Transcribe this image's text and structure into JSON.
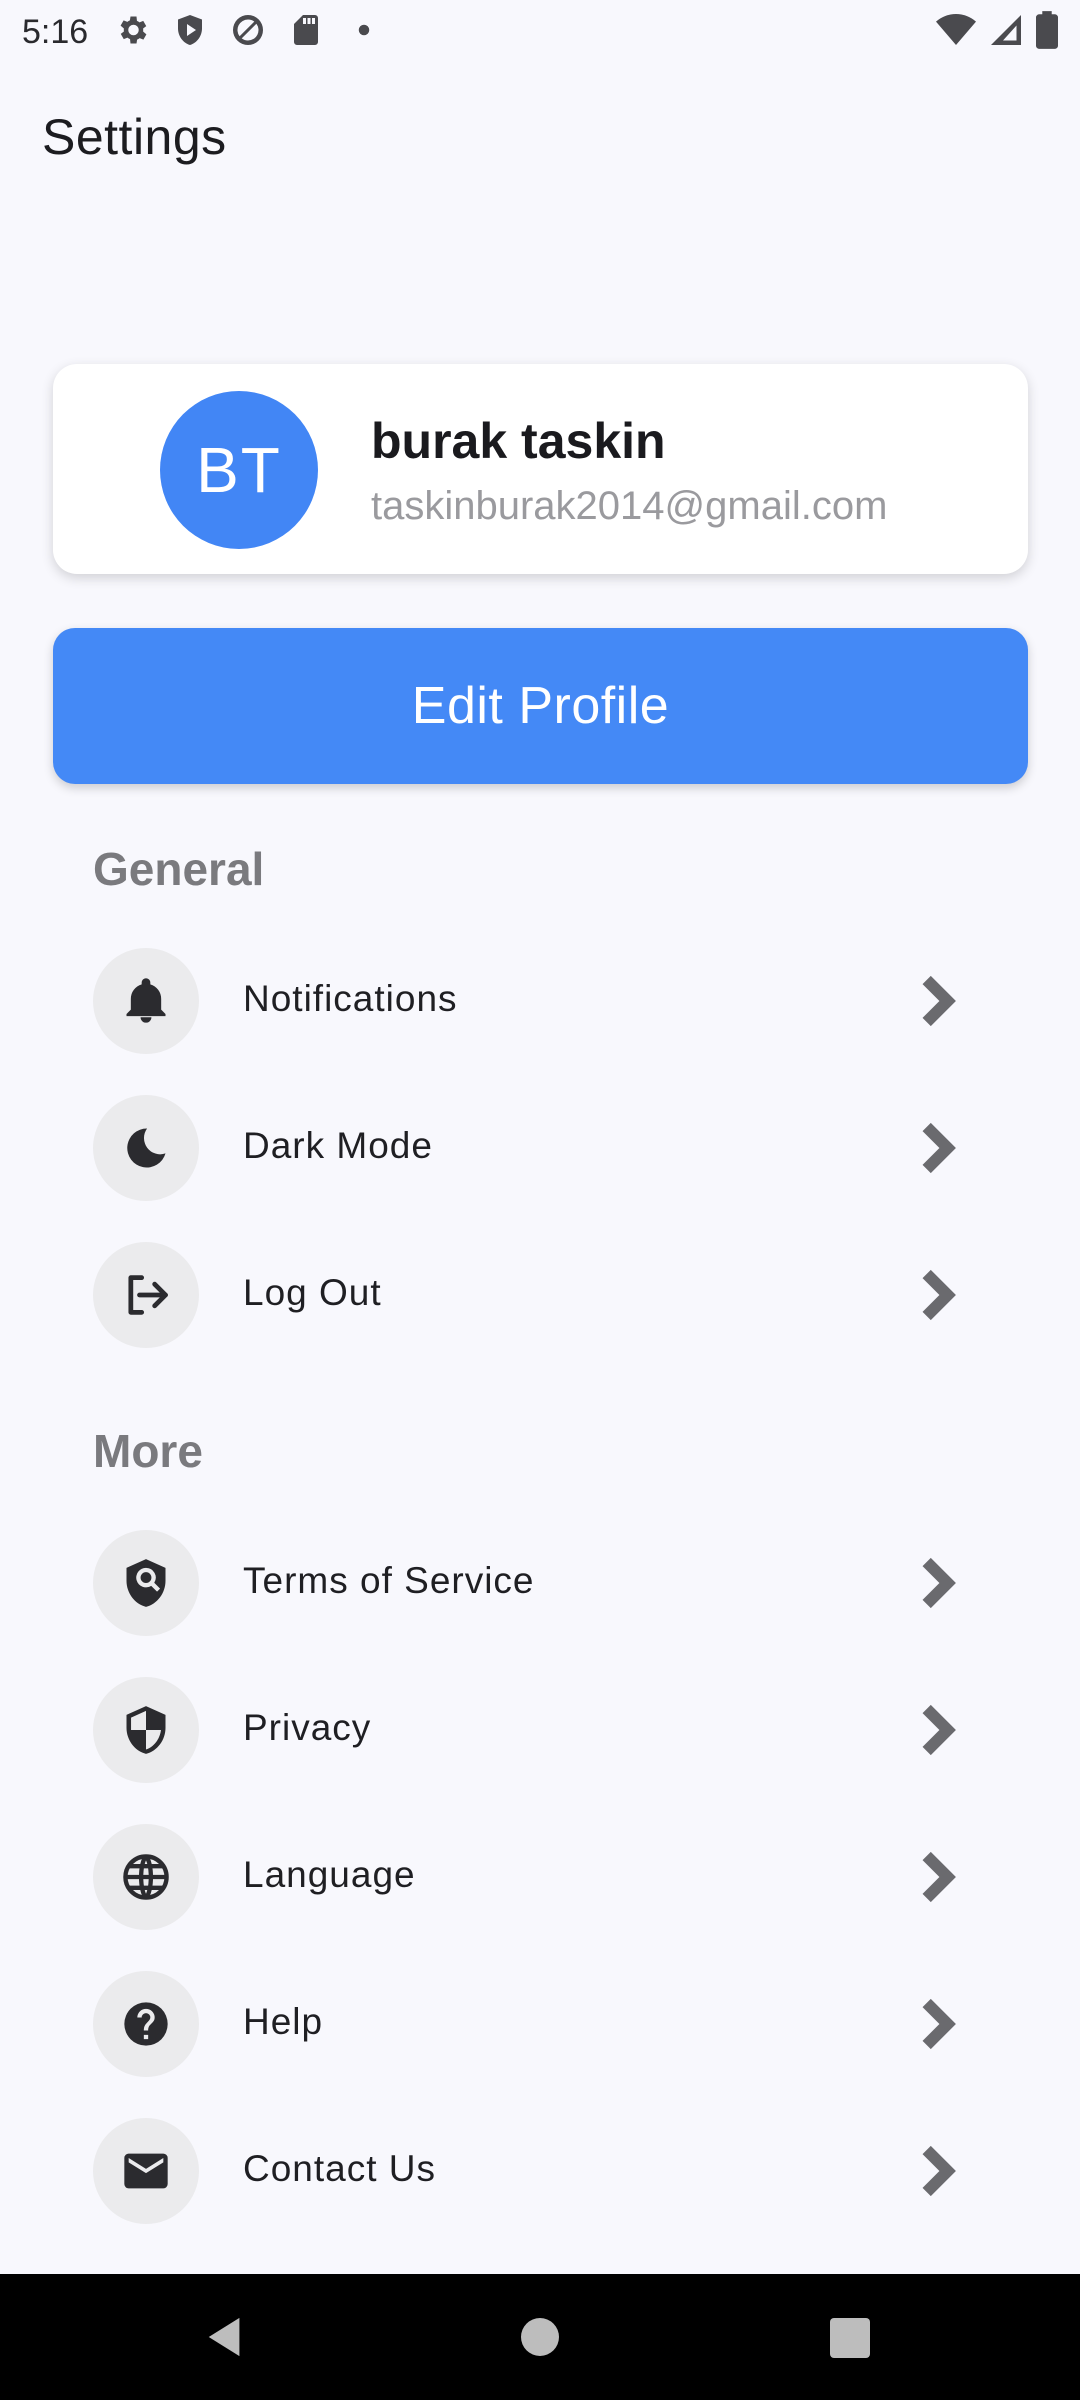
{
  "status_bar": {
    "time": "5:16",
    "left_icons": [
      "gear-icon",
      "shield-play-icon",
      "no-entry-icon",
      "sd-card-icon",
      "dot-icon"
    ],
    "right_icons": [
      "wifi-icon",
      "cell-signal-icon",
      "battery-icon"
    ]
  },
  "header": {
    "title": "Settings"
  },
  "profile": {
    "initials": "BT",
    "name": "burak taskin",
    "email": "taskinburak2014@gmail.com",
    "avatar_color": "#4286f5"
  },
  "edit_profile_label": "Edit Profile",
  "sections": {
    "general": {
      "title": "General",
      "items": [
        {
          "label": "Notifications",
          "icon": "bell-icon"
        },
        {
          "label": "Dark Mode",
          "icon": "moon-icon"
        },
        {
          "label": "Log Out",
          "icon": "logout-icon"
        }
      ]
    },
    "more": {
      "title": "More",
      "items": [
        {
          "label": "Terms of Service",
          "icon": "shield-search-icon"
        },
        {
          "label": "Privacy",
          "icon": "shield-half-icon"
        },
        {
          "label": "Language",
          "icon": "globe-icon"
        },
        {
          "label": "Help",
          "icon": "help-icon"
        },
        {
          "label": "Contact Us",
          "icon": "mail-icon"
        }
      ]
    }
  },
  "colors": {
    "accent": "#4489f6",
    "background": "#f8f8fd"
  }
}
